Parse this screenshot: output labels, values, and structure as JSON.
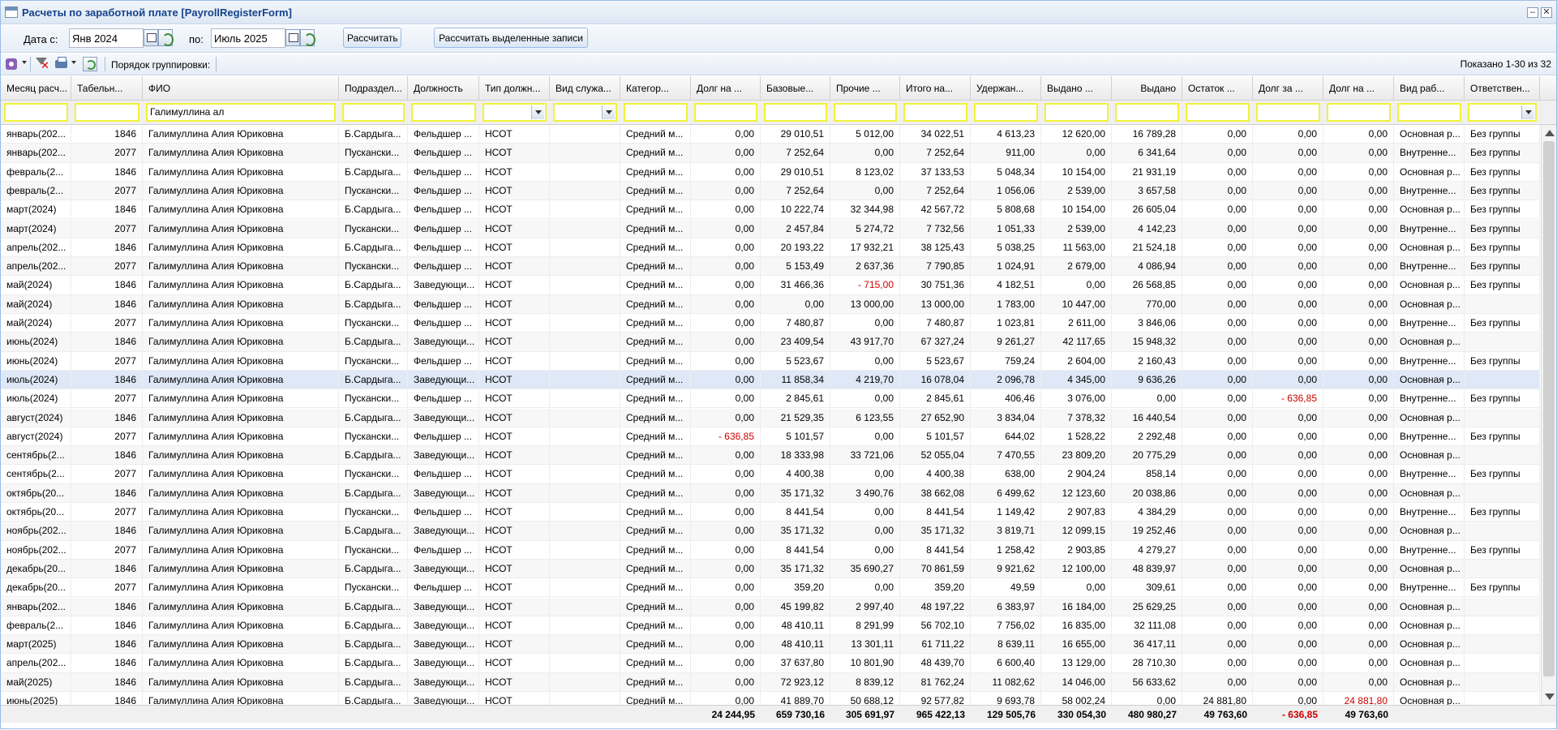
{
  "window": {
    "title": "Расчеты по заработной плате [PayrollRegisterForm]"
  },
  "filters": {
    "date_from_label": "Дата с:",
    "date_from": "Янв 2024",
    "date_to_label": "по:",
    "date_to": "Июль 2025",
    "calc_button": "Рассчитать",
    "calc_selected_button": "Рассчитать выделенные записи"
  },
  "toolbar": {
    "group_label": "Порядок группировки:",
    "shown": "Показано 1-30 из 32"
  },
  "columns": [
    {
      "label": "Месяц расч..."
    },
    {
      "label": "Табельн..."
    },
    {
      "label": "ФИО"
    },
    {
      "label": "Подраздел..."
    },
    {
      "label": "Должность"
    },
    {
      "label": "Тип должн..."
    },
    {
      "label": "Вид служа..."
    },
    {
      "label": "Категор..."
    },
    {
      "label": "Долг на ..."
    },
    {
      "label": "Базовые..."
    },
    {
      "label": "Прочие ..."
    },
    {
      "label": "Итого на..."
    },
    {
      "label": "Удержан..."
    },
    {
      "label": "Выдано ..."
    },
    {
      "label": "Выдано"
    },
    {
      "label": "Остаток ..."
    },
    {
      "label": "Долг за ..."
    },
    {
      "label": "Долг на ..."
    },
    {
      "label": "Вид раб..."
    },
    {
      "label": "Ответствен..."
    }
  ],
  "filter_values": {
    "fio": "Галимуллина ал"
  },
  "rows": [
    [
      "январь(202...",
      "1846",
      "Галимуллина Алия Юриковна",
      "Б.Сардыга...",
      "Фельдшер ...",
      "НСОТ",
      "",
      "Средний м...",
      "0,00",
      "29 010,51",
      "5 012,00",
      "34 022,51",
      "4 613,23",
      "12 620,00",
      "16 789,28",
      "0,00",
      "0,00",
      "0,00",
      "Основная р...",
      "Без группы"
    ],
    [
      "январь(202...",
      "2077",
      "Галимуллина Алия Юриковна",
      "Пускански...",
      "Фельдшер ...",
      "НСОТ",
      "",
      "Средний м...",
      "0,00",
      "7 252,64",
      "0,00",
      "7 252,64",
      "911,00",
      "0,00",
      "6 341,64",
      "0,00",
      "0,00",
      "0,00",
      "Внутренне...",
      "Без группы"
    ],
    [
      "февраль(2...",
      "1846",
      "Галимуллина Алия Юриковна",
      "Б.Сардыга...",
      "Фельдшер ...",
      "НСОТ",
      "",
      "Средний м...",
      "0,00",
      "29 010,51",
      "8 123,02",
      "37 133,53",
      "5 048,34",
      "10 154,00",
      "21 931,19",
      "0,00",
      "0,00",
      "0,00",
      "Основная р...",
      "Без группы"
    ],
    [
      "февраль(2...",
      "2077",
      "Галимуллина Алия Юриковна",
      "Пускански...",
      "Фельдшер ...",
      "НСОТ",
      "",
      "Средний м...",
      "0,00",
      "7 252,64",
      "0,00",
      "7 252,64",
      "1 056,06",
      "2 539,00",
      "3 657,58",
      "0,00",
      "0,00",
      "0,00",
      "Внутренне...",
      "Без группы"
    ],
    [
      "март(2024)",
      "1846",
      "Галимуллина Алия Юриковна",
      "Б.Сардыга...",
      "Фельдшер ...",
      "НСОТ",
      "",
      "Средний м...",
      "0,00",
      "10 222,74",
      "32 344,98",
      "42 567,72",
      "5 808,68",
      "10 154,00",
      "26 605,04",
      "0,00",
      "0,00",
      "0,00",
      "Основная р...",
      "Без группы"
    ],
    [
      "март(2024)",
      "2077",
      "Галимуллина Алия Юриковна",
      "Пускански...",
      "Фельдшер ...",
      "НСОТ",
      "",
      "Средний м...",
      "0,00",
      "2 457,84",
      "5 274,72",
      "7 732,56",
      "1 051,33",
      "2 539,00",
      "4 142,23",
      "0,00",
      "0,00",
      "0,00",
      "Внутренне...",
      "Без группы"
    ],
    [
      "апрель(202...",
      "1846",
      "Галимуллина Алия Юриковна",
      "Б.Сардыга...",
      "Фельдшер ...",
      "НСОТ",
      "",
      "Средний м...",
      "0,00",
      "20 193,22",
      "17 932,21",
      "38 125,43",
      "5 038,25",
      "11 563,00",
      "21 524,18",
      "0,00",
      "0,00",
      "0,00",
      "Основная р...",
      "Без группы"
    ],
    [
      "апрель(202...",
      "2077",
      "Галимуллина Алия Юриковна",
      "Пускански...",
      "Фельдшер ...",
      "НСОТ",
      "",
      "Средний м...",
      "0,00",
      "5 153,49",
      "2 637,36",
      "7 790,85",
      "1 024,91",
      "2 679,00",
      "4 086,94",
      "0,00",
      "0,00",
      "0,00",
      "Внутренне...",
      "Без группы"
    ],
    [
      "май(2024)",
      "1846",
      "Галимуллина Алия Юриковна",
      "Б.Сардыга...",
      "Заведующи...",
      "НСОТ",
      "",
      "Средний м...",
      "0,00",
      "31 466,36",
      "- 715,00",
      "30 751,36",
      "4 182,51",
      "0,00",
      "26 568,85",
      "0,00",
      "0,00",
      "0,00",
      "Основная р...",
      "Без группы"
    ],
    [
      "май(2024)",
      "1846",
      "Галимуллина Алия Юриковна",
      "Б.Сардыга...",
      "Фельдшер ...",
      "НСОТ",
      "",
      "Средний м...",
      "0,00",
      "0,00",
      "13 000,00",
      "13 000,00",
      "1 783,00",
      "10 447,00",
      "770,00",
      "0,00",
      "0,00",
      "0,00",
      "Основная р...",
      ""
    ],
    [
      "май(2024)",
      "2077",
      "Галимуллина Алия Юриковна",
      "Пускански...",
      "Фельдшер ...",
      "НСОТ",
      "",
      "Средний м...",
      "0,00",
      "7 480,87",
      "0,00",
      "7 480,87",
      "1 023,81",
      "2 611,00",
      "3 846,06",
      "0,00",
      "0,00",
      "0,00",
      "Внутренне...",
      "Без группы"
    ],
    [
      "июнь(2024)",
      "1846",
      "Галимуллина Алия Юриковна",
      "Б.Сардыга...",
      "Заведующи...",
      "НСОТ",
      "",
      "Средний м...",
      "0,00",
      "23 409,54",
      "43 917,70",
      "67 327,24",
      "9 261,27",
      "42 117,65",
      "15 948,32",
      "0,00",
      "0,00",
      "0,00",
      "Основная р...",
      ""
    ],
    [
      "июнь(2024)",
      "2077",
      "Галимуллина Алия Юриковна",
      "Пускански...",
      "Фельдшер ...",
      "НСОТ",
      "",
      "Средний м...",
      "0,00",
      "5 523,67",
      "0,00",
      "5 523,67",
      "759,24",
      "2 604,00",
      "2 160,43",
      "0,00",
      "0,00",
      "0,00",
      "Внутренне...",
      "Без группы"
    ],
    [
      "июль(2024)",
      "1846",
      "Галимуллина Алия Юриковна",
      "Б.Сардыга...",
      "Заведующи...",
      "НСОТ",
      "",
      "Средний м...",
      "0,00",
      "11 858,34",
      "4 219,70",
      "16 078,04",
      "2 096,78",
      "4 345,00",
      "9 636,26",
      "0,00",
      "0,00",
      "0,00",
      "Основная р...",
      ""
    ],
    [
      "июль(2024)",
      "2077",
      "Галимуллина Алия Юриковна",
      "Пускански...",
      "Фельдшер ...",
      "НСОТ",
      "",
      "Средний м...",
      "0,00",
      "2 845,61",
      "0,00",
      "2 845,61",
      "406,46",
      "3 076,00",
      "0,00",
      "0,00",
      "- 636,85",
      "0,00",
      "Внутренне...",
      "Без группы"
    ],
    [
      "август(2024)",
      "1846",
      "Галимуллина Алия Юриковна",
      "Б.Сардыга...",
      "Заведующи...",
      "НСОТ",
      "",
      "Средний м...",
      "0,00",
      "21 529,35",
      "6 123,55",
      "27 652,90",
      "3 834,04",
      "7 378,32",
      "16 440,54",
      "0,00",
      "0,00",
      "0,00",
      "Основная р...",
      ""
    ],
    [
      "август(2024)",
      "2077",
      "Галимуллина Алия Юриковна",
      "Пускански...",
      "Фельдшер ...",
      "НСОТ",
      "",
      "Средний м...",
      "- 636,85",
      "5 101,57",
      "0,00",
      "5 101,57",
      "644,02",
      "1 528,22",
      "2 292,48",
      "0,00",
      "0,00",
      "0,00",
      "Внутренне...",
      "Без группы"
    ],
    [
      "сентябрь(2...",
      "1846",
      "Галимуллина Алия Юриковна",
      "Б.Сардыга...",
      "Заведующи...",
      "НСОТ",
      "",
      "Средний м...",
      "0,00",
      "18 333,98",
      "33 721,06",
      "52 055,04",
      "7 470,55",
      "23 809,20",
      "20 775,29",
      "0,00",
      "0,00",
      "0,00",
      "Основная р...",
      ""
    ],
    [
      "сентябрь(2...",
      "2077",
      "Галимуллина Алия Юриковна",
      "Пускански...",
      "Фельдшер ...",
      "НСОТ",
      "",
      "Средний м...",
      "0,00",
      "4 400,38",
      "0,00",
      "4 400,38",
      "638,00",
      "2 904,24",
      "858,14",
      "0,00",
      "0,00",
      "0,00",
      "Внутренне...",
      "Без группы"
    ],
    [
      "октябрь(20...",
      "1846",
      "Галимуллина Алия Юриковна",
      "Б.Сардыга...",
      "Заведующи...",
      "НСОТ",
      "",
      "Средний м...",
      "0,00",
      "35 171,32",
      "3 490,76",
      "38 662,08",
      "6 499,62",
      "12 123,60",
      "20 038,86",
      "0,00",
      "0,00",
      "0,00",
      "Основная р...",
      ""
    ],
    [
      "октябрь(20...",
      "2077",
      "Галимуллина Алия Юриковна",
      "Пускански...",
      "Фельдшер ...",
      "НСОТ",
      "",
      "Средний м...",
      "0,00",
      "8 441,54",
      "0,00",
      "8 441,54",
      "1 149,42",
      "2 907,83",
      "4 384,29",
      "0,00",
      "0,00",
      "0,00",
      "Внутренне...",
      "Без группы"
    ],
    [
      "ноябрь(202...",
      "1846",
      "Галимуллина Алия Юриковна",
      "Б.Сардыга...",
      "Заведующи...",
      "НСОТ",
      "",
      "Средний м...",
      "0,00",
      "35 171,32",
      "0,00",
      "35 171,32",
      "3 819,71",
      "12 099,15",
      "19 252,46",
      "0,00",
      "0,00",
      "0,00",
      "Основная р...",
      ""
    ],
    [
      "ноябрь(202...",
      "2077",
      "Галимуллина Алия Юриковна",
      "Пускански...",
      "Фельдшер ...",
      "НСОТ",
      "",
      "Средний м...",
      "0,00",
      "8 441,54",
      "0,00",
      "8 441,54",
      "1 258,42",
      "2 903,85",
      "4 279,27",
      "0,00",
      "0,00",
      "0,00",
      "Внутренне...",
      "Без группы"
    ],
    [
      "декабрь(20...",
      "1846",
      "Галимуллина Алия Юриковна",
      "Б.Сардыга...",
      "Заведующи...",
      "НСОТ",
      "",
      "Средний м...",
      "0,00",
      "35 171,32",
      "35 690,27",
      "70 861,59",
      "9 921,62",
      "12 100,00",
      "48 839,97",
      "0,00",
      "0,00",
      "0,00",
      "Основная р...",
      ""
    ],
    [
      "декабрь(20...",
      "2077",
      "Галимуллина Алия Юриковна",
      "Пускански...",
      "Фельдшер ...",
      "НСОТ",
      "",
      "Средний м...",
      "0,00",
      "359,20",
      "0,00",
      "359,20",
      "49,59",
      "0,00",
      "309,61",
      "0,00",
      "0,00",
      "0,00",
      "Внутренне...",
      "Без группы"
    ],
    [
      "январь(202...",
      "1846",
      "Галимуллина Алия Юриковна",
      "Б.Сардыга...",
      "Заведующи...",
      "НСОТ",
      "",
      "Средний м...",
      "0,00",
      "45 199,82",
      "2 997,40",
      "48 197,22",
      "6 383,97",
      "16 184,00",
      "25 629,25",
      "0,00",
      "0,00",
      "0,00",
      "Основная р...",
      ""
    ],
    [
      "февраль(2...",
      "1846",
      "Галимуллина Алия Юриковна",
      "Б.Сардыга...",
      "Заведующи...",
      "НСОТ",
      "",
      "Средний м...",
      "0,00",
      "48 410,11",
      "8 291,99",
      "56 702,10",
      "7 756,02",
      "16 835,00",
      "32 111,08",
      "0,00",
      "0,00",
      "0,00",
      "Основная р...",
      ""
    ],
    [
      "март(2025)",
      "1846",
      "Галимуллина Алия Юриковна",
      "Б.Сардыга...",
      "Заведующи...",
      "НСОТ",
      "",
      "Средний м...",
      "0,00",
      "48 410,11",
      "13 301,11",
      "61 711,22",
      "8 639,11",
      "16 655,00",
      "36 417,11",
      "0,00",
      "0,00",
      "0,00",
      "Основная р...",
      ""
    ],
    [
      "апрель(202...",
      "1846",
      "Галимуллина Алия Юриковна",
      "Б.Сардыга...",
      "Заведующи...",
      "НСОТ",
      "",
      "Средний м...",
      "0,00",
      "37 637,80",
      "10 801,90",
      "48 439,70",
      "6 600,40",
      "13 129,00",
      "28 710,30",
      "0,00",
      "0,00",
      "0,00",
      "Основная р...",
      ""
    ],
    [
      "май(2025)",
      "1846",
      "Галимуллина Алия Юриковна",
      "Б.Сардыга...",
      "Заведующи...",
      "НСОТ",
      "",
      "Средний м...",
      "0,00",
      "72 923,12",
      "8 839,12",
      "81 762,24",
      "11 082,62",
      "14 046,00",
      "56 633,62",
      "0,00",
      "0,00",
      "0,00",
      "Основная р...",
      ""
    ],
    [
      "июнь(2025)",
      "1846",
      "Галимуллина Алия Юриковна",
      "Б.Сардыга...",
      "Заведующи...",
      "НСОТ",
      "",
      "Средний м...",
      "0,00",
      "41 889,70",
      "50 688,12",
      "92 577,82",
      "9 693,78",
      "58 002,24",
      "0,00",
      "24 881,80",
      "0,00",
      "24 881,80",
      "Основная р...",
      ""
    ]
  ],
  "selected_row": 13,
  "totals": [
    "24 244,95",
    "659 730,16",
    "305 691,97",
    "965 422,13",
    "129 505,76",
    "330 054,30",
    "480 980,27",
    "49 763,60",
    "- 636,85",
    "49 763,60"
  ],
  "colors": {
    "negative": "#cc0000",
    "filter_border": "#f2f23a",
    "selection": "#dfe8f6"
  }
}
